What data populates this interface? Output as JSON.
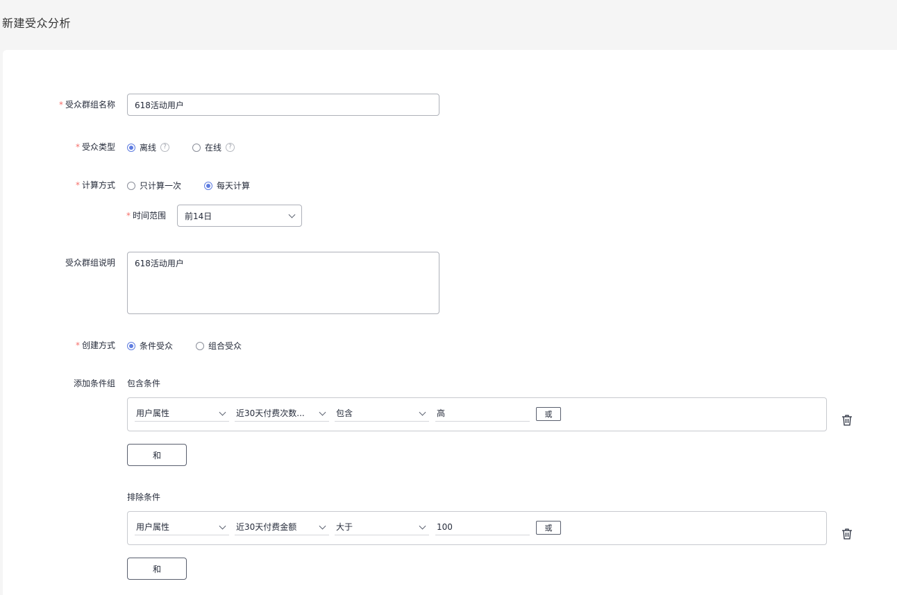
{
  "page": {
    "title": "新建受众分析"
  },
  "form": {
    "name": {
      "label": "受众群组名称",
      "value": "618活动用户"
    },
    "type": {
      "label": "受众类型",
      "options": [
        "离线",
        "在线"
      ],
      "selected": "离线"
    },
    "calc": {
      "label": "计算方式",
      "options": [
        "只计算一次",
        "每天计算"
      ],
      "selected": "每天计算"
    },
    "time_range": {
      "label": "时间范围",
      "value": "前14日"
    },
    "desc": {
      "label": "受众群组说明",
      "value": "618活动用户"
    },
    "create": {
      "label": "创建方式",
      "options": [
        "条件受众",
        "组合受众"
      ],
      "selected": "条件受众"
    },
    "add_group": {
      "label": "添加条件组"
    },
    "include": {
      "title": "包含条件",
      "field": "用户属性",
      "attribute": "近30天付费次数...",
      "operator": "包含",
      "value": "高",
      "or_label": "或",
      "and_label": "和"
    },
    "exclude": {
      "title": "排除条件",
      "field": "用户属性",
      "attribute": "近30天付费金额",
      "operator": "大于",
      "value": "100",
      "or_label": "或",
      "and_label": "和"
    }
  },
  "icons": {
    "help": "question-circle-icon",
    "dropdown": "chevron-down-icon",
    "delete": "trash-icon"
  },
  "colors": {
    "accent": "#5e7ce0",
    "required": "#f66f6a"
  }
}
